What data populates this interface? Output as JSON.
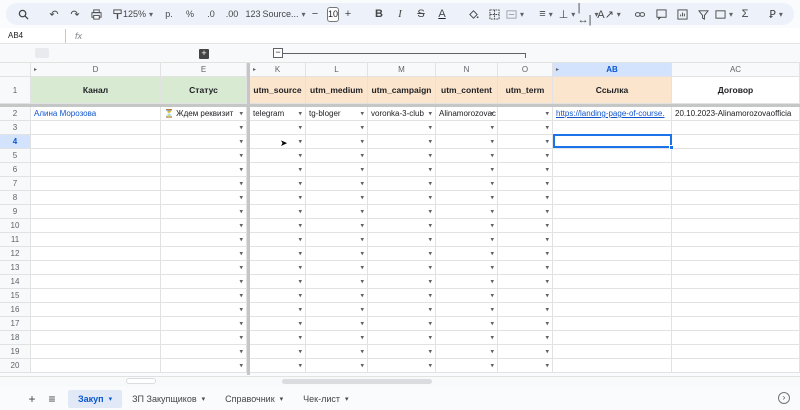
{
  "toolbar": {
    "zoom": "125%",
    "currency": "р.",
    "percent": "%",
    "dec_dec": ".0",
    "dec_inc": ".00",
    "number_format": "123",
    "font": "Source...",
    "font_size": "10",
    "bold": "B",
    "italic": "I",
    "strike": "S",
    "text_color": "A"
  },
  "formula_bar": {
    "name_box": "AB4",
    "fx": "fx",
    "value": ""
  },
  "columns": [
    {
      "letter": "",
      "header": ""
    },
    {
      "letter": "D",
      "header": "Канал"
    },
    {
      "letter": "E",
      "header": "Статус"
    },
    {
      "letter": "K",
      "header": "utm_source"
    },
    {
      "letter": "L",
      "header": "utm_medium"
    },
    {
      "letter": "M",
      "header": "utm_campaign"
    },
    {
      "letter": "N",
      "header": "utm_content"
    },
    {
      "letter": "O",
      "header": "utm_term"
    },
    {
      "letter": "AB",
      "header": "Ссылка"
    },
    {
      "letter": "AC",
      "header": "Договор"
    }
  ],
  "header_row_number": "1",
  "row2": {
    "number": "2",
    "kanal": "Алина Морозова",
    "status": "⏳ Ждем реквизит",
    "utm_source": "telegram",
    "utm_medium": "tg-bloger",
    "utm_campaign": "voronka-3-club",
    "utm_content": "Alinamorozovac",
    "utm_term": "",
    "link": "https://landing-page-of-course.",
    "contract": "20.10.2023-Alinamorozovaofficia"
  },
  "row_numbers": [
    "3",
    "4",
    "5",
    "6",
    "7",
    "8",
    "9",
    "10",
    "11",
    "12",
    "13",
    "14",
    "15",
    "16",
    "17",
    "18",
    "19",
    "20"
  ],
  "selected_row": "4",
  "selected_col": "AB",
  "sheets": [
    {
      "name": "Закуп",
      "active": true
    },
    {
      "name": "ЗП Закупщиков",
      "active": false
    },
    {
      "name": "Справочник",
      "active": false
    },
    {
      "name": "Чек-лист",
      "active": false
    }
  ],
  "colors": {
    "header_green": "#d9ead3",
    "header_orange": "#fce5cd",
    "selection": "#1a73e8"
  },
  "icons": [
    "search-icon",
    "undo-icon",
    "redo-icon",
    "print-icon",
    "paint-format-icon",
    "fill-color-icon",
    "borders-icon",
    "merge-icon",
    "align-icon",
    "valign-icon",
    "wrap-icon",
    "rotate-icon",
    "link-icon",
    "comment-icon",
    "chart-icon",
    "filter-icon",
    "filter-views-icon",
    "functions-icon",
    "input-tools-icon",
    "collapse-icon"
  ]
}
